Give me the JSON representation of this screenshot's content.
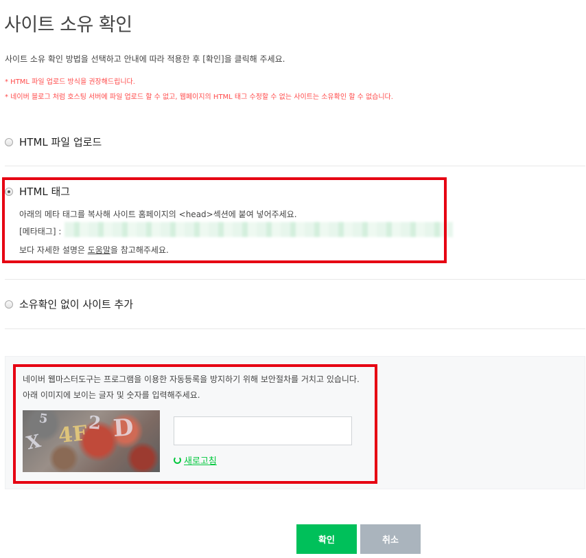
{
  "page": {
    "title": "사이트 소유 확인",
    "description": "사이트 소유 확인 방법을 선택하고 안내에 따라 적용한 후 [확인]을 클릭해 주세요.",
    "notes": [
      "* HTML 파일 업로드 방식을 권장해드립니다.",
      "* 네이버 블로그 처럼 호스팅 서버에 파일 업로드 할 수 없고, 웹페이지의 HTML 태그 수정할 수 없는 사이트는 소유확인 할 수 없습니다."
    ]
  },
  "options": {
    "html_file": {
      "label": "HTML 파일 업로드",
      "selected": false
    },
    "html_tag": {
      "label": "HTML 태그",
      "selected": true,
      "instruction": "아래의 메타 태그를 복사해 사이트 홈페이지의 <head>섹션에 붙여 넣어주세요.",
      "meta_label": "[메타태그] :",
      "help_prefix": "보다 자세한 설명은 ",
      "help_link": "도움말",
      "help_suffix": "을 참고해주세요."
    },
    "no_verify": {
      "label": "소유확인 없이 사이트 추가",
      "selected": false
    }
  },
  "captcha": {
    "line1": "네이버 웹마스터도구는 프로그램을 이용한 자동등록을 방지하기 위해 보안절차를 거치고 있습니다.",
    "line2": "아래 이미지에 보이는 글자 및 숫자를 입력해주세요.",
    "image_chars": [
      "X",
      "5",
      "4F",
      "2",
      "D"
    ],
    "input_value": "",
    "refresh_label": "새로고침"
  },
  "buttons": {
    "confirm": "확인",
    "cancel": "취소"
  },
  "colors": {
    "accent_green": "#00c05a",
    "highlight_red": "#e60012",
    "note_red": "#ff4a4a",
    "cancel_gray": "#aab4bd"
  }
}
